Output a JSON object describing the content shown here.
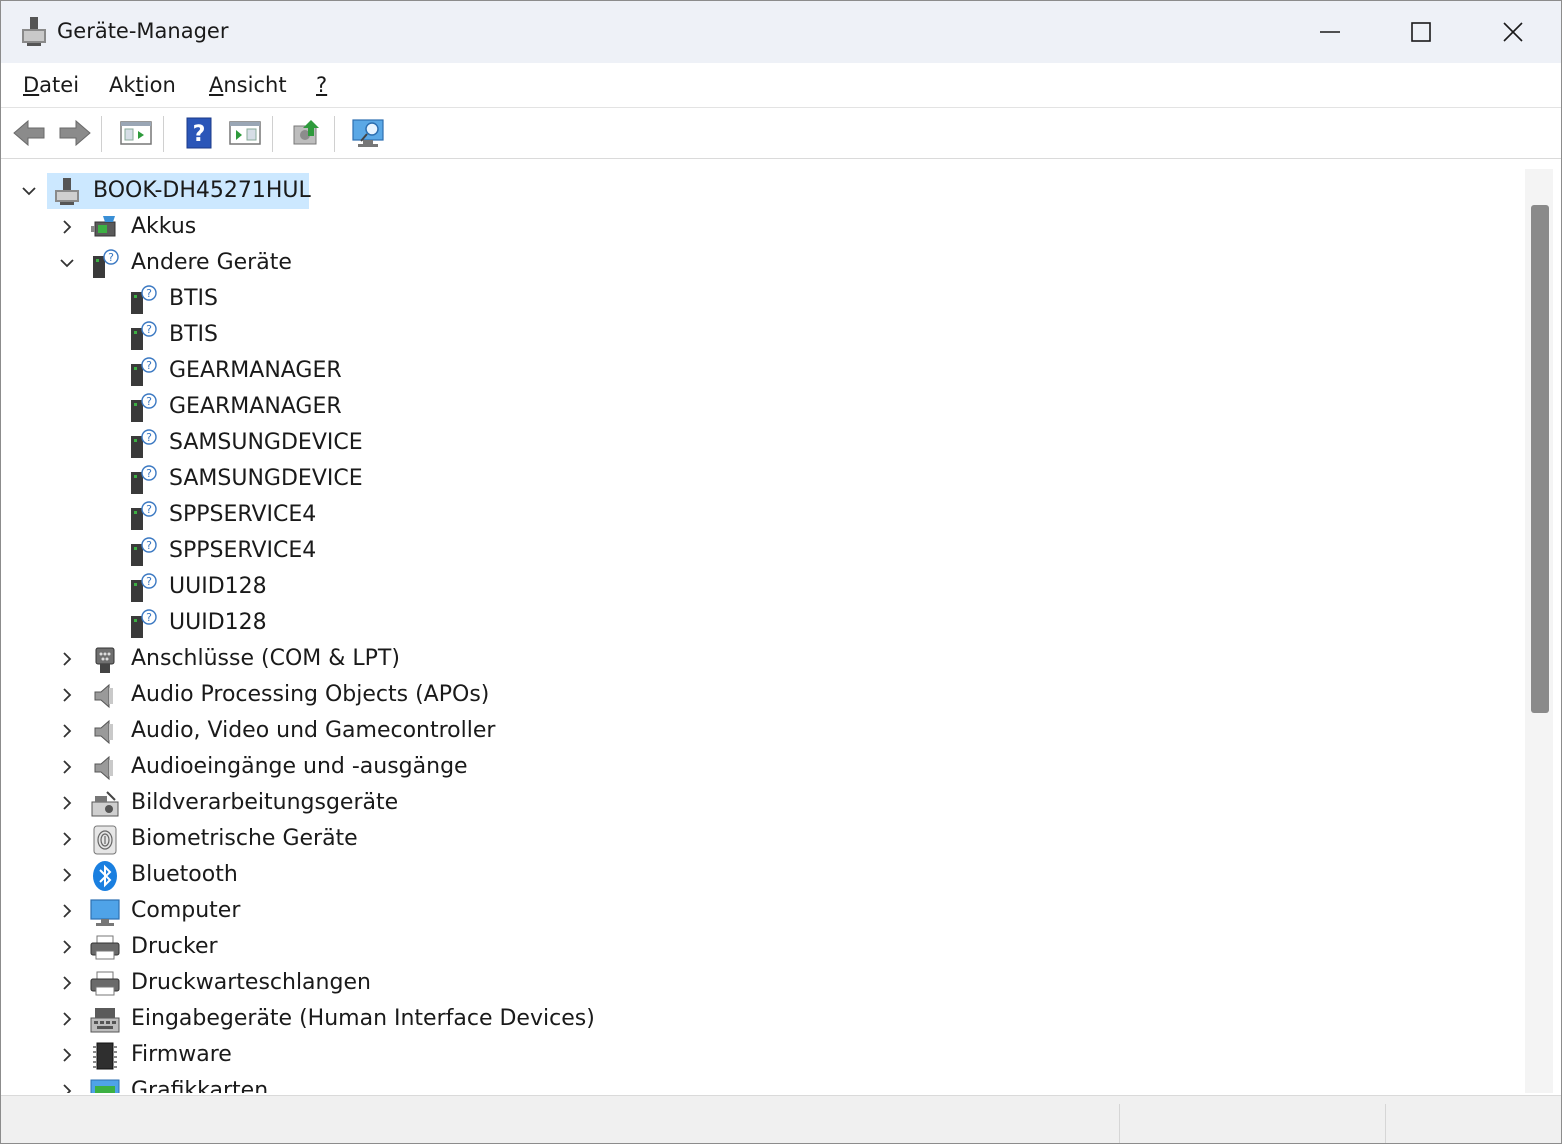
{
  "window": {
    "title": "Geräte-Manager",
    "controls": [
      "minimize",
      "maximize",
      "close"
    ]
  },
  "menu": [
    {
      "label": "Datei",
      "mnemonic": "D",
      "rest": "atei"
    },
    {
      "label": "Aktion",
      "pre": "Ak",
      "mnemonic": "t",
      "rest": "ion"
    },
    {
      "label": "Ansicht",
      "mnemonic": "A",
      "rest": "nsicht"
    },
    {
      "label": "?",
      "mnemonic": "?",
      "rest": ""
    }
  ],
  "toolbar": {
    "buttons": [
      "back-arrow-icon",
      "forward-arrow-icon",
      "properties-console-icon",
      "help-icon",
      "run-console-icon",
      "update-driver-icon",
      "scan-hardware-icon"
    ]
  },
  "tree": {
    "root": "BOOK-DH45271HUL",
    "categories": [
      {
        "label": "Akkus",
        "icon": "battery-icon",
        "expanded": false
      },
      {
        "label": "Andere Geräte",
        "icon": "unknown-device-icon",
        "expanded": true,
        "children": [
          "BTIS",
          "BTIS",
          "GEARMANAGER",
          "GEARMANAGER",
          "SAMSUNGDEVICE",
          "SAMSUNGDEVICE",
          "SPPSERVICE4",
          "SPPSERVICE4",
          "UUID128",
          "UUID128"
        ]
      },
      {
        "label": "Anschlüsse (COM & LPT)",
        "icon": "port-icon",
        "expanded": false
      },
      {
        "label": "Audio Processing Objects (APOs)",
        "icon": "speaker-icon",
        "expanded": false
      },
      {
        "label": "Audio, Video und Gamecontroller",
        "icon": "speaker-icon",
        "expanded": false
      },
      {
        "label": "Audioeingänge und -ausgänge",
        "icon": "speaker-icon",
        "expanded": false
      },
      {
        "label": "Bildverarbeitungsgeräte",
        "icon": "camera-icon",
        "expanded": false
      },
      {
        "label": "Biometrische Geräte",
        "icon": "fingerprint-icon",
        "expanded": false
      },
      {
        "label": "Bluetooth",
        "icon": "bluetooth-icon",
        "expanded": false
      },
      {
        "label": "Computer",
        "icon": "monitor-icon",
        "expanded": false
      },
      {
        "label": "Drucker",
        "icon": "printer-icon",
        "expanded": false
      },
      {
        "label": "Druckwarteschlangen",
        "icon": "printer-icon",
        "expanded": false
      },
      {
        "label": "Eingabegeräte (Human Interface Devices)",
        "icon": "hid-icon",
        "expanded": false
      },
      {
        "label": "Firmware",
        "icon": "chip-icon",
        "expanded": false
      },
      {
        "label": "Grafikkarten",
        "icon": "display-adapter-icon",
        "expanded": false
      }
    ]
  },
  "colors": {
    "selection": "#cce8ff",
    "titlebar": "#eef1f7",
    "bluetooth": "#1a7fe0",
    "scroll_thumb": "#8a8a8a"
  }
}
